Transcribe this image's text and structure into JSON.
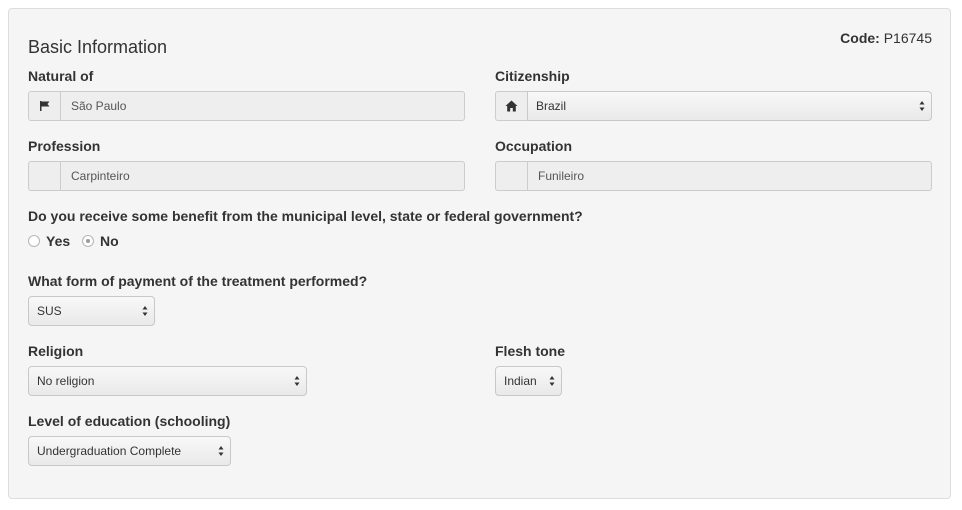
{
  "panel": {
    "title": "Basic Information",
    "code_label": "Code:",
    "code_value": "P16745"
  },
  "natural_of": {
    "label": "Natural of",
    "value": "São Paulo",
    "icon": "flag-icon"
  },
  "citizenship": {
    "label": "Citizenship",
    "value": "Brazil",
    "icon": "home-icon"
  },
  "profession": {
    "label": "Profession",
    "value": "Carpinteiro"
  },
  "occupation": {
    "label": "Occupation",
    "value": "Funileiro"
  },
  "benefit": {
    "question": "Do you receive some benefit from the municipal level, state or federal government?",
    "options": [
      {
        "label": "Yes",
        "checked": false
      },
      {
        "label": "No",
        "checked": true
      }
    ]
  },
  "payment": {
    "question": "What form of payment of the treatment performed?",
    "value": "SUS"
  },
  "religion": {
    "label": "Religion",
    "value": "No religion"
  },
  "flesh_tone": {
    "label": "Flesh tone",
    "value": "Indian"
  },
  "education": {
    "label": "Level of education (schooling)",
    "value": "Undergraduation Complete"
  }
}
